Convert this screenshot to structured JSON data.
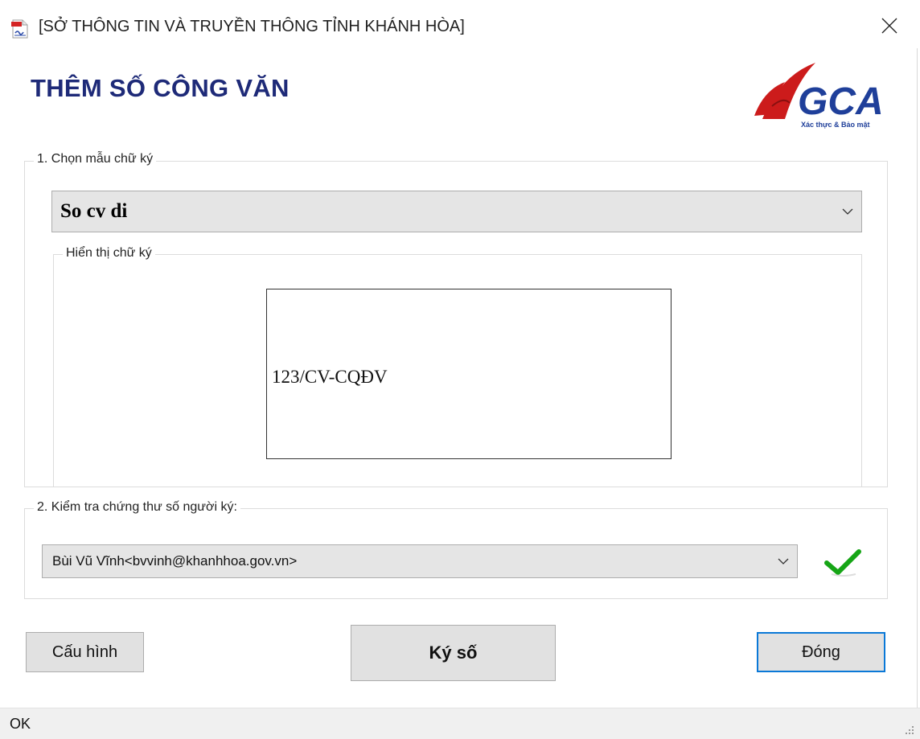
{
  "window": {
    "title": "[SỞ THÔNG TIN VÀ TRUYỀN THÔNG TỈNH KHÁNH HÒA]",
    "icon": "document-signature-icon",
    "close_icon": "close-icon"
  },
  "header": {
    "page_title": "THÊM SỐ CÔNG VĂN",
    "logo": {
      "text": "VGCA",
      "tagline": "Xác thực & Bảo mật"
    }
  },
  "signature_template": {
    "legend": "1. Chọn mẫu chữ ký",
    "selected": "So cv di",
    "preview": {
      "legend": "Hiển thị chữ ký",
      "text": "123/CV-CQĐV"
    }
  },
  "certificate": {
    "legend": "2. Kiểm tra chứng thư số người ký:",
    "selected": "Bùi Vũ Vĩnh<bvvinh@khanhhoa.gov.vn>",
    "status_icon": "check-icon"
  },
  "buttons": {
    "config": "Cấu hình",
    "sign": "Ký số",
    "close": "Đóng"
  },
  "statusbar": {
    "text": "OK"
  },
  "colors": {
    "title": "#1e2a78",
    "logo_red": "#cc1b1b",
    "logo_blue": "#1f3f9a",
    "check_green": "#16a516",
    "focus_border": "#0a78d7"
  }
}
